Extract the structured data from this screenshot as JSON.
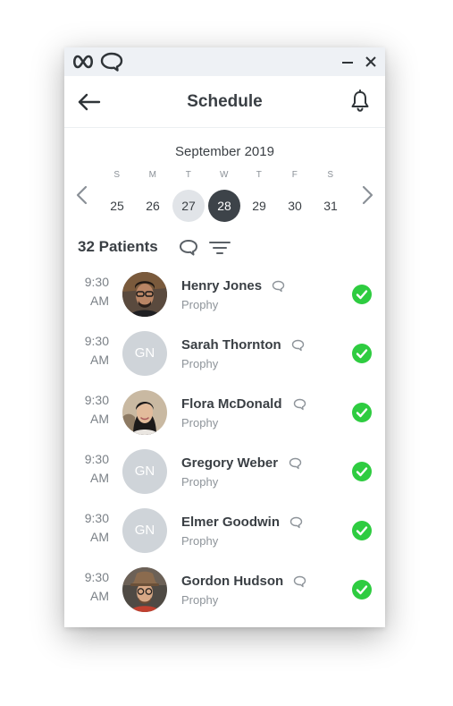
{
  "header": {
    "title": "Schedule"
  },
  "calendar": {
    "month": "September 2019",
    "days": [
      {
        "dow": "S",
        "date": "25",
        "state": "normal"
      },
      {
        "dow": "M",
        "date": "26",
        "state": "normal"
      },
      {
        "dow": "T",
        "date": "27",
        "state": "today"
      },
      {
        "dow": "W",
        "date": "28",
        "state": "selected"
      },
      {
        "dow": "T",
        "date": "29",
        "state": "normal"
      },
      {
        "dow": "F",
        "date": "30",
        "state": "normal"
      },
      {
        "dow": "S",
        "date": "31",
        "state": "normal"
      }
    ]
  },
  "summary": {
    "count_label": "32 Patients"
  },
  "patients": [
    {
      "time": "9:30",
      "ampm": "AM",
      "name": "Henry Jones",
      "type": "Prophy",
      "avatar": "photo-man-glasses",
      "initials": ""
    },
    {
      "time": "9:30",
      "ampm": "AM",
      "name": "Sarah Thornton",
      "type": "Prophy",
      "avatar": "initials",
      "initials": "GN"
    },
    {
      "time": "9:30",
      "ampm": "AM",
      "name": "Flora McDonald",
      "type": "Prophy",
      "avatar": "photo-woman",
      "initials": ""
    },
    {
      "time": "9:30",
      "ampm": "AM",
      "name": "Gregory Weber",
      "type": "Prophy",
      "avatar": "initials",
      "initials": "GN"
    },
    {
      "time": "9:30",
      "ampm": "AM",
      "name": "Elmer Goodwin",
      "type": "Prophy",
      "avatar": "initials",
      "initials": "GN"
    },
    {
      "time": "9:30",
      "ampm": "AM",
      "name": "Gordon Hudson",
      "type": "Prophy",
      "avatar": "photo-man-hat",
      "initials": ""
    }
  ],
  "colors": {
    "accent_dark": "#3d4349",
    "today_bg": "#e1e4e8",
    "check_green": "#2ecc40",
    "initials_bg": "#cfd4d9"
  },
  "icons": [
    "infinity-logo-icon",
    "chat-logo-icon",
    "minimize-icon",
    "close-icon",
    "back-arrow-icon",
    "bell-icon",
    "chevron-left-icon",
    "chevron-right-icon",
    "chat-bubble-icon",
    "filter-icon",
    "check-circle-icon"
  ]
}
